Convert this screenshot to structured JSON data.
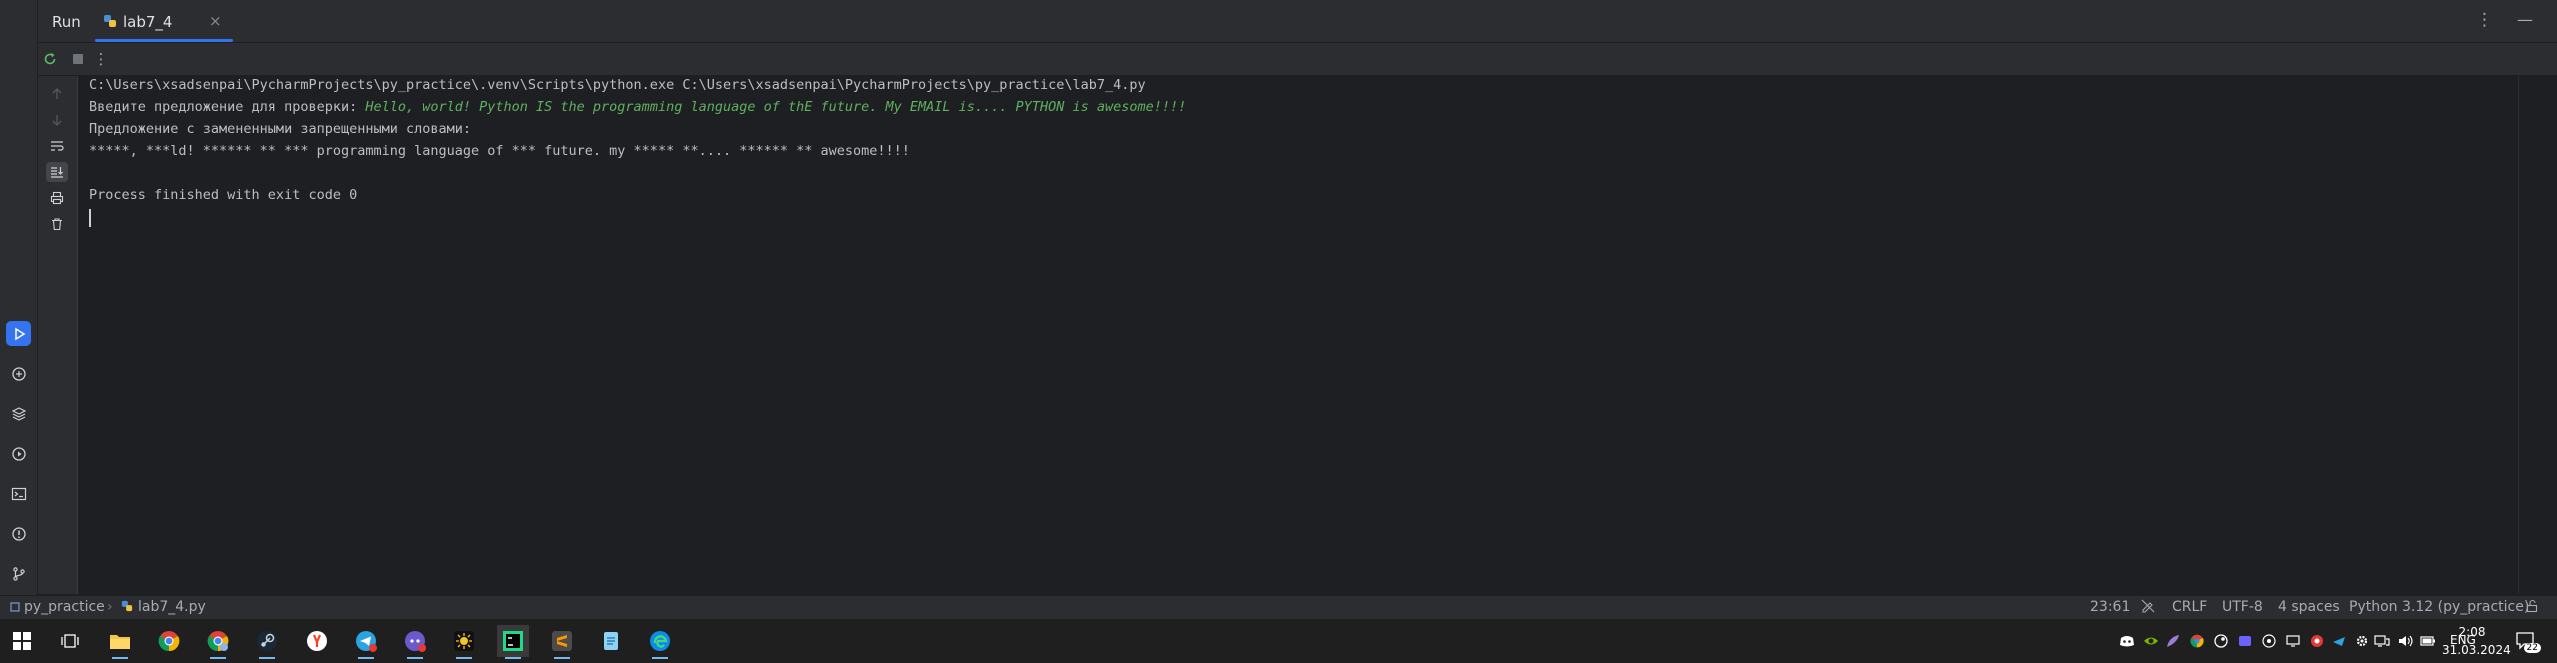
{
  "window": {
    "run_label": "Run",
    "tab_title": "lab7_4",
    "tab_close": "×",
    "options_glyph": "⋮",
    "minimize_glyph": "—",
    "toolbar_more_glyph": "⋮"
  },
  "console": {
    "command_line": "C:\\Users\\xsadsenpai\\PycharmProjects\\py_practice\\.venv\\Scripts\\python.exe C:\\Users\\xsadsenpai\\PycharmProjects\\py_practice\\lab7_4.py",
    "prompt_label": "Введите предложение для проверки: ",
    "prompt_input": "Hello, world! Python IS the programming language of thE future. My EMAIL is.... PYTHON is awesome!!!!",
    "replaced_header": "Предложение с замененными запрещенными словами:",
    "replaced_output": "*****, ***ld! ****** ** *** programming language of *** future. my ***** **.... ****** ** awesome!!!!",
    "exit_message": "Process finished with exit code 0"
  },
  "statusbar": {
    "project": "py_practice",
    "separator": "›",
    "file": "lab7_4.py",
    "position": "23:61",
    "line_ending": "CRLF",
    "encoding": "UTF-8",
    "indent": "4 spaces",
    "interpreter": "Python 3.12 (py_practice)"
  },
  "taskbar": {
    "language": "ENG",
    "time": "2:08",
    "date": "31.03.2024",
    "notification_count": "22"
  },
  "colors": {
    "accent": "#3574f0",
    "input_text": "#5fb05f",
    "panel": "#2b2d30",
    "editor_bg": "#1e1f22"
  }
}
